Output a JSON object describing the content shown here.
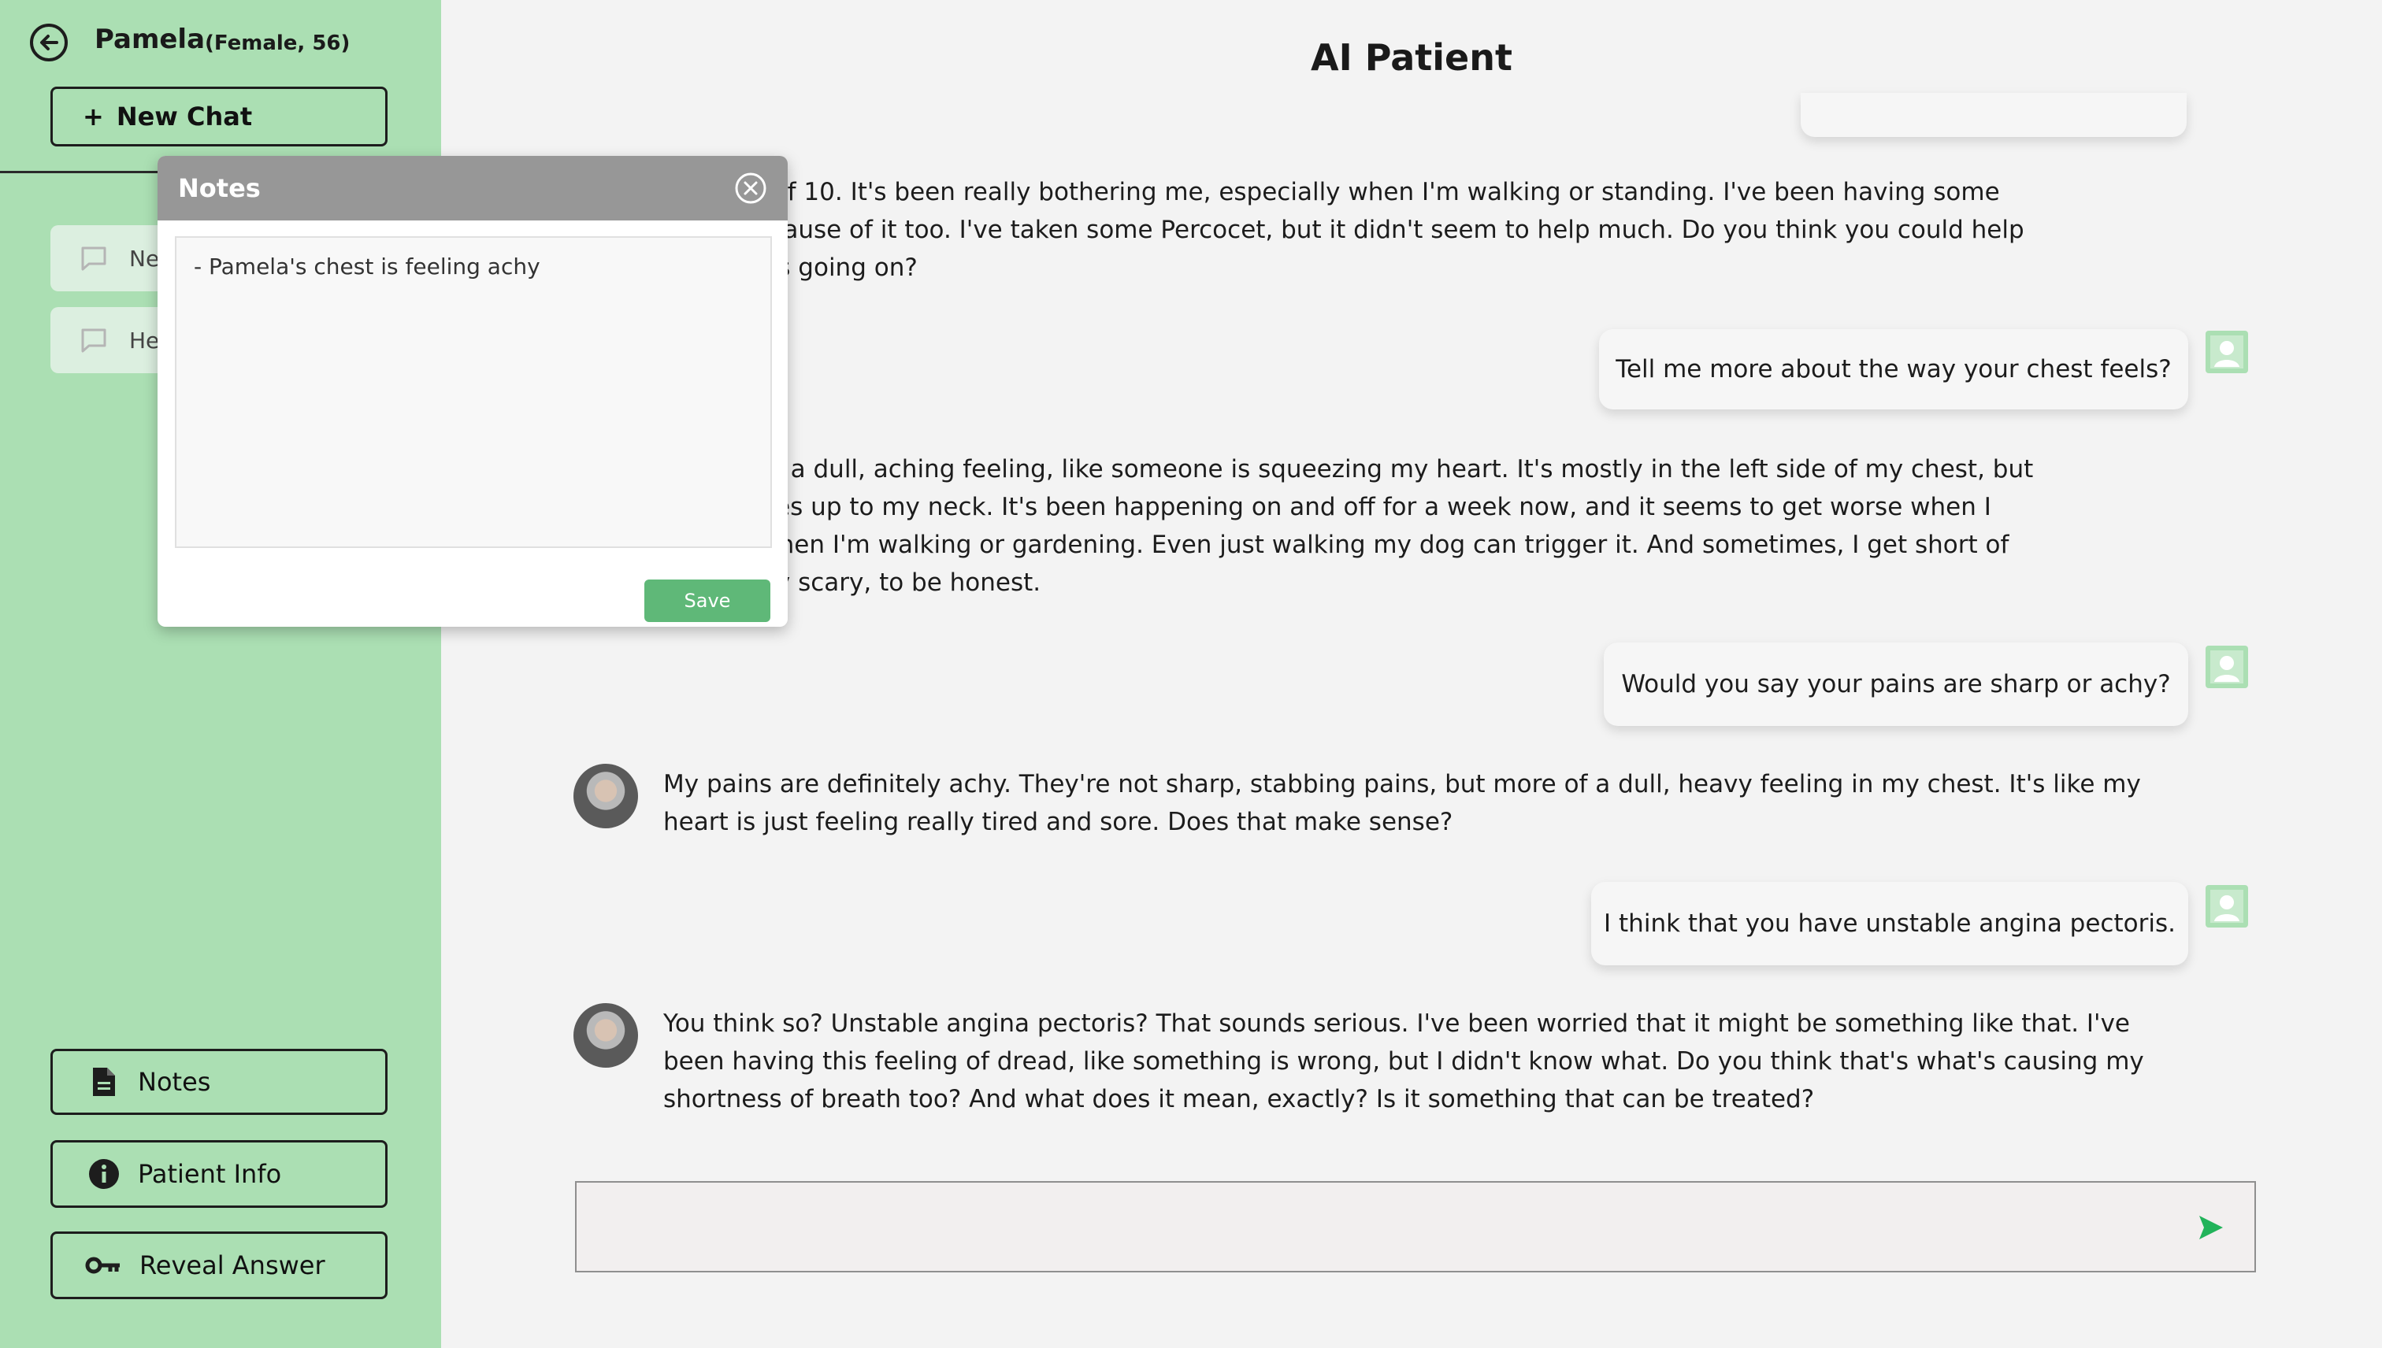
{
  "sidebar": {
    "patient_name": "Pamela",
    "patient_meta": "(Female, 56)",
    "new_chat_label": "New Chat",
    "history": [
      {
        "label": "Ne"
      },
      {
        "label": "He"
      }
    ],
    "notes_label": "Notes",
    "patient_info_label": "Patient Info",
    "reveal_answer_label": "Reveal Answer",
    "accent_color": "#abdfb3"
  },
  "header": {
    "title": "AI Patient"
  },
  "messages": [
    {
      "role": "patient",
      "lines": [
        "an 8 out of 10. It's been really bothering me, especially when I'm walking or standing. I've been having some",
        "eping because of it too. I've taken some Percocet, but it didn't seem to help much. Do you think you could help",
        "out what's going on?"
      ]
    },
    {
      "role": "user",
      "text": "Tell me more about the way your chest feels?"
    },
    {
      "role": "patient",
      "lines": [
        "pain... it's a dull, aching feeling, like someone is squeezing my heart. It's mostly in the left side of my chest, but",
        "; it radiates up to my neck. It's been happening on and off for a week now, and it seems to get worse when I",
        "elf, like when I'm walking or gardening. Even just walking my dog can trigger it. And sometimes, I get short of",
        ". It's really scary, to be honest."
      ]
    },
    {
      "role": "user",
      "text": "Would you say your pains are sharp or achy?"
    },
    {
      "role": "patient",
      "lines": [
        "My pains are definitely achy. They're not sharp, stabbing pains, but more of a dull, heavy feeling in my chest. It's like my",
        "heart is just feeling really tired and sore. Does that make sense?"
      ]
    },
    {
      "role": "user",
      "text": "I think that you have unstable angina pectoris."
    },
    {
      "role": "patient",
      "lines": [
        "You think so? Unstable angina pectoris? That sounds serious. I've been worried that it might be something like that. I've",
        "been having this feeling of dread, like something is wrong, but I didn't know what. Do you think that's what's causing my",
        "shortness of breath too? And what does it mean, exactly? Is it something that can be treated?"
      ]
    }
  ],
  "input": {
    "value": "",
    "send_icon": "send-arrow-icon",
    "send_color": "#22b35a"
  },
  "notes_popup": {
    "title": "Notes",
    "content": "- Pamela's chest is feeling achy",
    "save_label": "Save",
    "save_color": "#5fb878"
  }
}
